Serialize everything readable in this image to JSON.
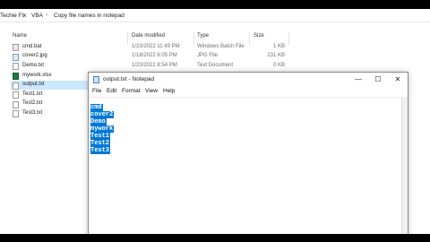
{
  "explorer": {
    "breadcrumb": [
      "Techie Fix",
      "VBA",
      "Copy file names in notepad"
    ],
    "columns": {
      "name": "Name",
      "date_modified": "Date modified",
      "type": "Type",
      "size": "Size"
    },
    "files": [
      {
        "name": "cmd.bat",
        "date": "1/23/2022 11:49 PM",
        "type": "Windows Batch File",
        "size": "1 KB",
        "icon": "batch-file-icon"
      },
      {
        "name": "cover2.jpg",
        "date": "1/18/2022 6:05 PM",
        "type": "JPG File",
        "size": "231 KB",
        "icon": "image-file-icon"
      },
      {
        "name": "Demo.txt",
        "date": "1/23/2022 8:54 PM",
        "type": "Text Document",
        "size": "0 KB",
        "icon": "text-file-icon"
      },
      {
        "name": "mywork.xlsx",
        "date": "",
        "type": "",
        "size": "",
        "icon": "excel-file-icon"
      },
      {
        "name": "output.txt",
        "date": "",
        "type": "",
        "size": "",
        "icon": "text-file-icon",
        "selected": true
      },
      {
        "name": "Test1.txt",
        "date": "",
        "type": "",
        "size": "",
        "icon": "text-file-icon"
      },
      {
        "name": "Test2.txt",
        "date": "",
        "type": "",
        "size": "",
        "icon": "text-file-icon"
      },
      {
        "name": "Test3.txt",
        "date": "",
        "type": "",
        "size": "",
        "icon": "text-file-icon"
      }
    ]
  },
  "notepad": {
    "title": "output.txt - Notepad",
    "menu": [
      "File",
      "Edit",
      "Format",
      "View",
      "Help"
    ],
    "buttons": {
      "minimize": "—",
      "maximize": "☐",
      "close": "✕"
    },
    "lines": [
      "cmd",
      "cover2",
      "Demo",
      "mywork",
      "Test1",
      "Test2",
      "Test3"
    ],
    "selection_color": "#0078d7"
  }
}
